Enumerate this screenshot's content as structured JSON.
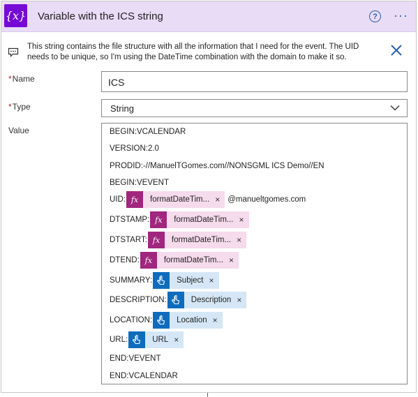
{
  "header": {
    "icon_text": "{x}",
    "title": "Variable with the ICS string",
    "help_glyph": "?",
    "more_glyph": "···",
    "accent_color": "#770bd6"
  },
  "comment": {
    "text": "This string contains the file structure with all the information that I need for the event. The UID needs to be unique, so I'm using the DateTime combination with the domain to make it so."
  },
  "fields": {
    "name": {
      "required_mark": "*",
      "label": "Name",
      "value": "ICS"
    },
    "type": {
      "required_mark": "*",
      "label": "Type",
      "value": "String"
    },
    "value": {
      "label": "Value"
    }
  },
  "value_lines": {
    "l1": "BEGIN:VCALENDAR",
    "l2": "VERSION:2.0",
    "l3": "PRODID:-//ManuelTGomes.com//NONSGML ICS Demo//EN",
    "l4": "BEGIN:VEVENT",
    "uid": {
      "prefix": "UID:",
      "token": "formatDateTim...",
      "suffix": "@manueltgomes.com"
    },
    "dtstamp": {
      "prefix": "DTSTAMP:",
      "token": "formatDateTim..."
    },
    "dtstart": {
      "prefix": "DTSTART:",
      "token": "formatDateTim..."
    },
    "dtend": {
      "prefix": "DTEND:",
      "token": "formatDateTim..."
    },
    "summary": {
      "prefix": "SUMMARY:",
      "token": "Subject"
    },
    "description": {
      "prefix": "DESCRIPTION:",
      "token": "Description"
    },
    "location": {
      "prefix": "LOCATION:",
      "token": "Location"
    },
    "url": {
      "prefix": "URL:",
      "token": "URL"
    },
    "l13": "END:VEVENT",
    "l14": "END:VCALENDAR"
  },
  "token_glyphs": {
    "fx": "fx",
    "remove": "×"
  },
  "icons": [
    "variable-icon",
    "help-icon",
    "more-icon",
    "comment-icon",
    "close-icon",
    "chevron-down-icon",
    "expression-icon",
    "dynamic-content-icon"
  ],
  "colors": {
    "header_bg": "#e9dcf7",
    "expression": "#a0267e",
    "dynamic_content": "#0f6cbd",
    "required": "#a4262c"
  }
}
